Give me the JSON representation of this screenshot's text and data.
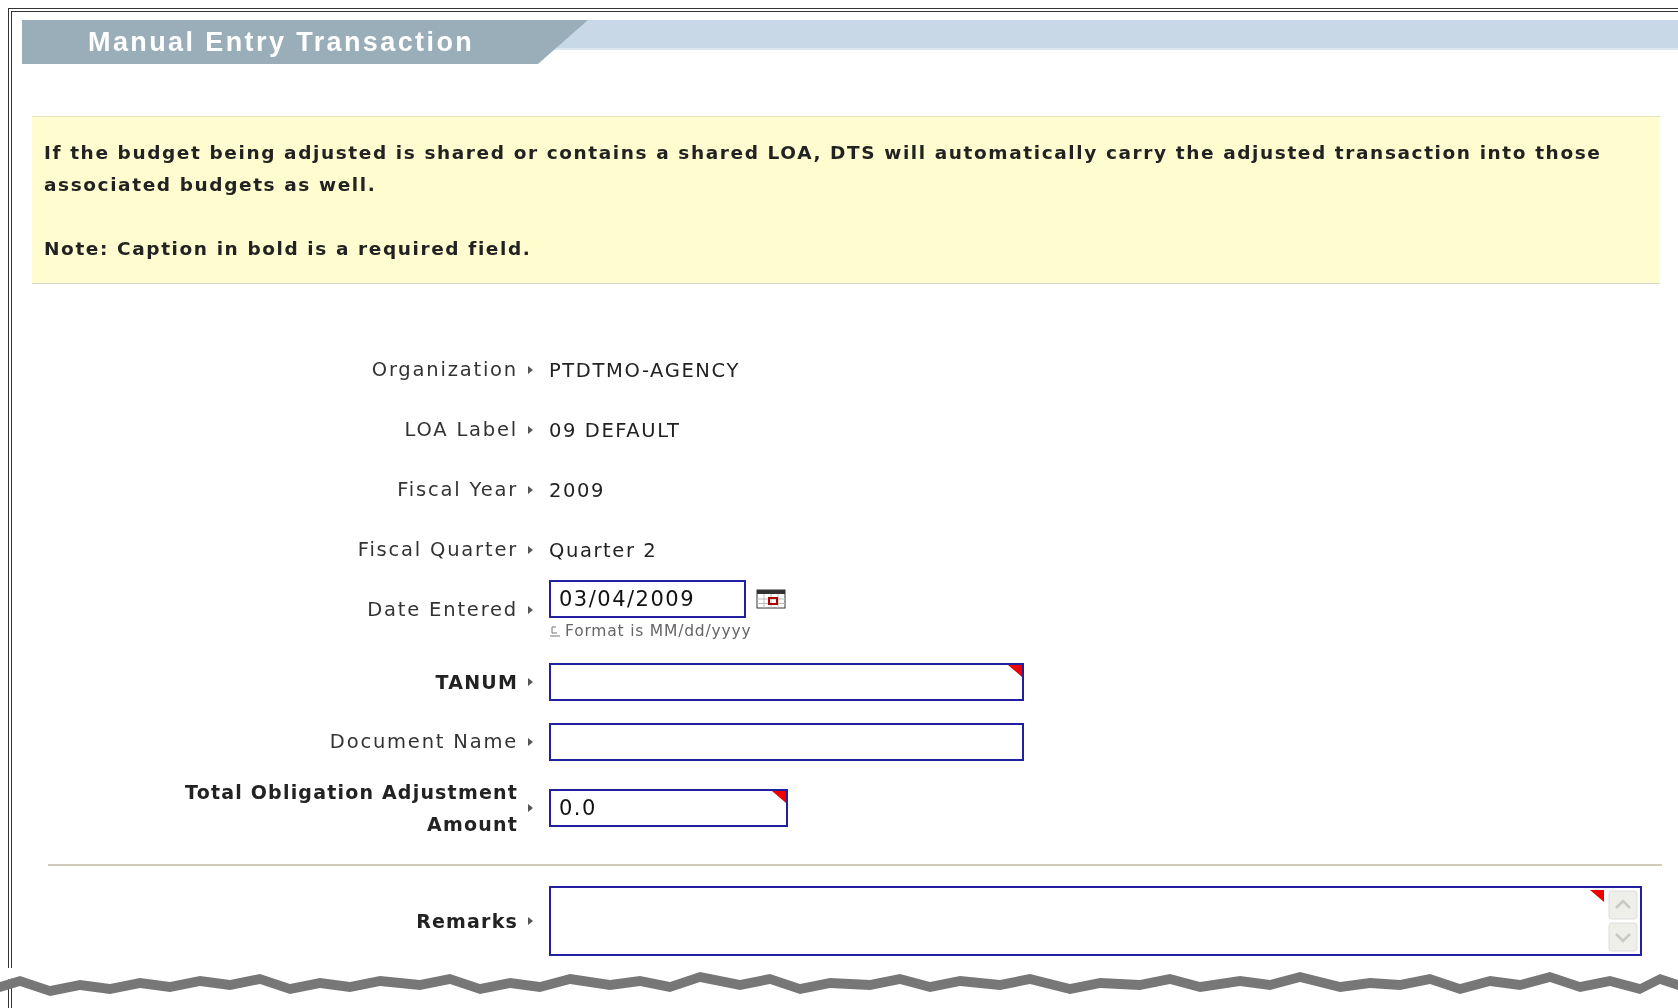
{
  "title": "Manual Entry Transaction",
  "notice": {
    "message": "If the budget being adjusted is shared or contains a shared LOA, DTS will automatically carry the adjusted transaction into those associated budgets as well.",
    "note": "Note: Caption in bold is a required field."
  },
  "fields": [
    {
      "kind": "text",
      "label": "Organization",
      "value": "PTDTMO-AGENCY",
      "required": false
    },
    {
      "kind": "text",
      "label": "LOA Label",
      "value": "09 DEFAULT",
      "required": false
    },
    {
      "kind": "text",
      "label": "Fiscal Year",
      "value": "2009",
      "required": false
    },
    {
      "kind": "text",
      "label": "Fiscal Quarter",
      "value": "Quarter 2",
      "required": false
    },
    {
      "kind": "date",
      "label": "Date Entered",
      "value": "03/04/2009",
      "hint": "Format is MM/dd/yyyy",
      "required": false
    },
    {
      "kind": "input",
      "label": "TANUM",
      "required": true
    },
    {
      "kind": "input",
      "label": "Document Name",
      "required": false
    },
    {
      "kind": "amount",
      "label": "Total Obligation Adjustment Amount",
      "value": "0.0",
      "required": true
    }
  ],
  "remarks": {
    "label": "Remarks",
    "required": true
  }
}
